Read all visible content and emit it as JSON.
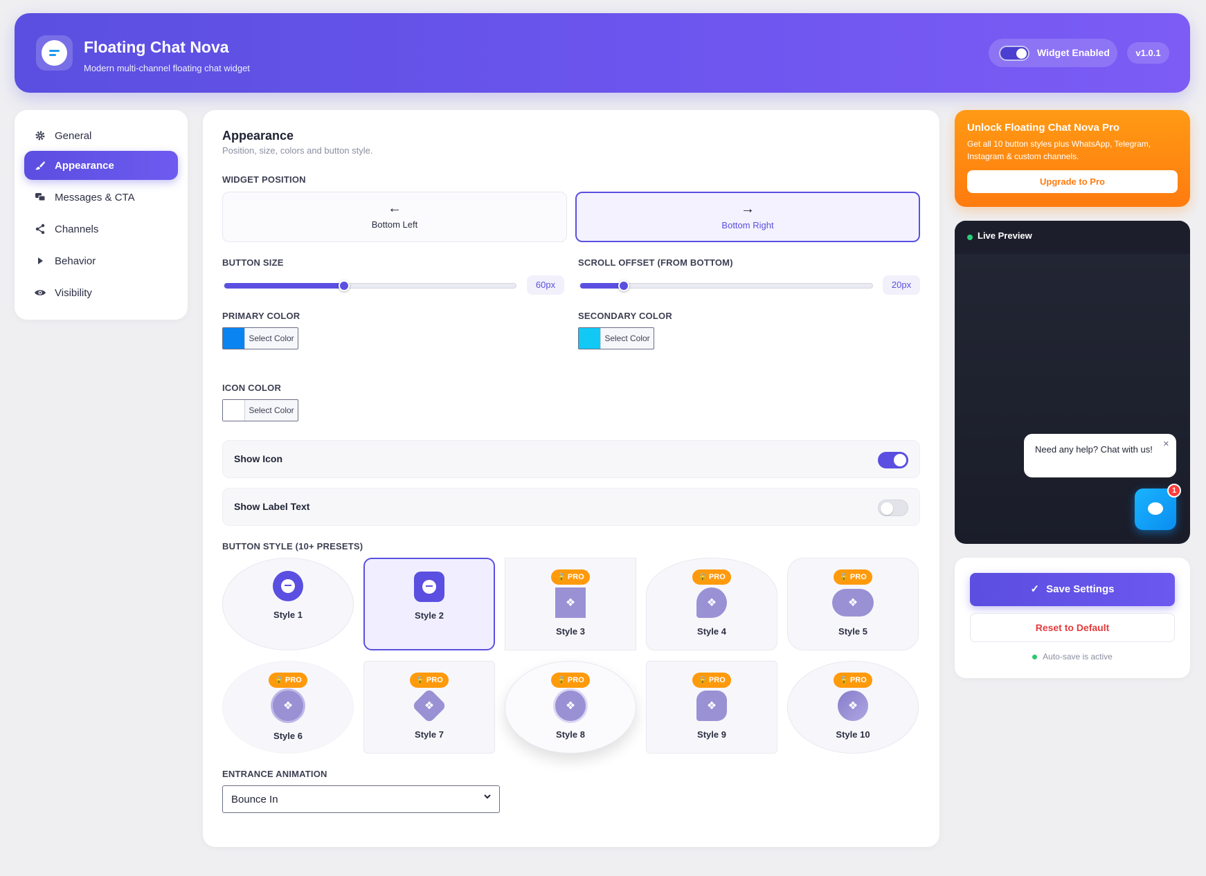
{
  "header": {
    "title": "Floating Chat Nova",
    "subtitle": "Modern multi-channel floating chat widget",
    "widget_toggle_label": "Widget Enabled",
    "widget_enabled": true,
    "version": "v1.0.1"
  },
  "sidebar": {
    "items": [
      {
        "label": "General",
        "icon": "gear-icon",
        "active": false
      },
      {
        "label": "Appearance",
        "icon": "brush-icon",
        "active": true
      },
      {
        "label": "Messages & CTA",
        "icon": "messages-icon",
        "active": false
      },
      {
        "label": "Channels",
        "icon": "share-icon",
        "active": false
      },
      {
        "label": "Behavior",
        "icon": "play-icon",
        "active": false
      },
      {
        "label": "Visibility",
        "icon": "eye-icon",
        "active": false
      }
    ]
  },
  "main": {
    "title": "Appearance",
    "subtitle": "Position, size, colors and button style.",
    "widget_position": {
      "label": "WIDGET POSITION",
      "options": [
        {
          "label": "Bottom Left",
          "icon": "arrow-left-icon",
          "selected": false
        },
        {
          "label": "Bottom Right",
          "icon": "arrow-right-icon",
          "selected": true
        }
      ]
    },
    "button_size": {
      "label": "BUTTON SIZE",
      "value": "60px",
      "fraction": 0.41
    },
    "scroll_offset": {
      "label": "SCROLL OFFSET (FROM BOTTOM)",
      "value": "20px",
      "fraction": 0.15
    },
    "primary_color": {
      "label": "PRIMARY COLOR",
      "button": "Select Color",
      "color": "#0a84f0"
    },
    "secondary_color": {
      "label": "SECONDARY COLOR",
      "button": "Select Color",
      "color": "#12c8f5"
    },
    "icon_color": {
      "label": "ICON COLOR",
      "button": "Select Color",
      "color": "#ffffff"
    },
    "show_icon": {
      "label": "Show Icon",
      "on": true
    },
    "show_label_text": {
      "label": "Show Label Text",
      "on": false
    },
    "button_style": {
      "label": "BUTTON STYLE (10+ PRESETS)",
      "pro_label": "PRO",
      "styles": [
        {
          "name": "Style 1",
          "pro": false,
          "selected": false
        },
        {
          "name": "Style 2",
          "pro": false,
          "selected": true
        },
        {
          "name": "Style 3",
          "pro": true,
          "selected": false
        },
        {
          "name": "Style 4",
          "pro": true,
          "selected": false
        },
        {
          "name": "Style 5",
          "pro": true,
          "selected": false
        },
        {
          "name": "Style 6",
          "pro": true,
          "selected": false
        },
        {
          "name": "Style 7",
          "pro": true,
          "selected": false
        },
        {
          "name": "Style 8",
          "pro": true,
          "selected": false
        },
        {
          "name": "Style 9",
          "pro": true,
          "selected": false
        },
        {
          "name": "Style 10",
          "pro": true,
          "selected": false
        }
      ]
    },
    "entrance_animation": {
      "label": "ENTRANCE ANIMATION",
      "value": "Bounce In"
    }
  },
  "promo": {
    "title": "Unlock Floating Chat Nova Pro",
    "description": "Get all 10 button styles plus WhatsApp, Telegram, Instagram & custom channels.",
    "button": "Upgrade to Pro"
  },
  "preview": {
    "title": "Live Preview",
    "bubble_text": "Need any help? Chat with us!",
    "badge_count": "1"
  },
  "actions": {
    "save": "Save Settings",
    "reset": "Reset to Default",
    "autosave": "Auto-save is active"
  },
  "colors": {
    "accent": "#5a4fe0",
    "pro": "#ff9a0c",
    "danger": "#e23b3b"
  }
}
